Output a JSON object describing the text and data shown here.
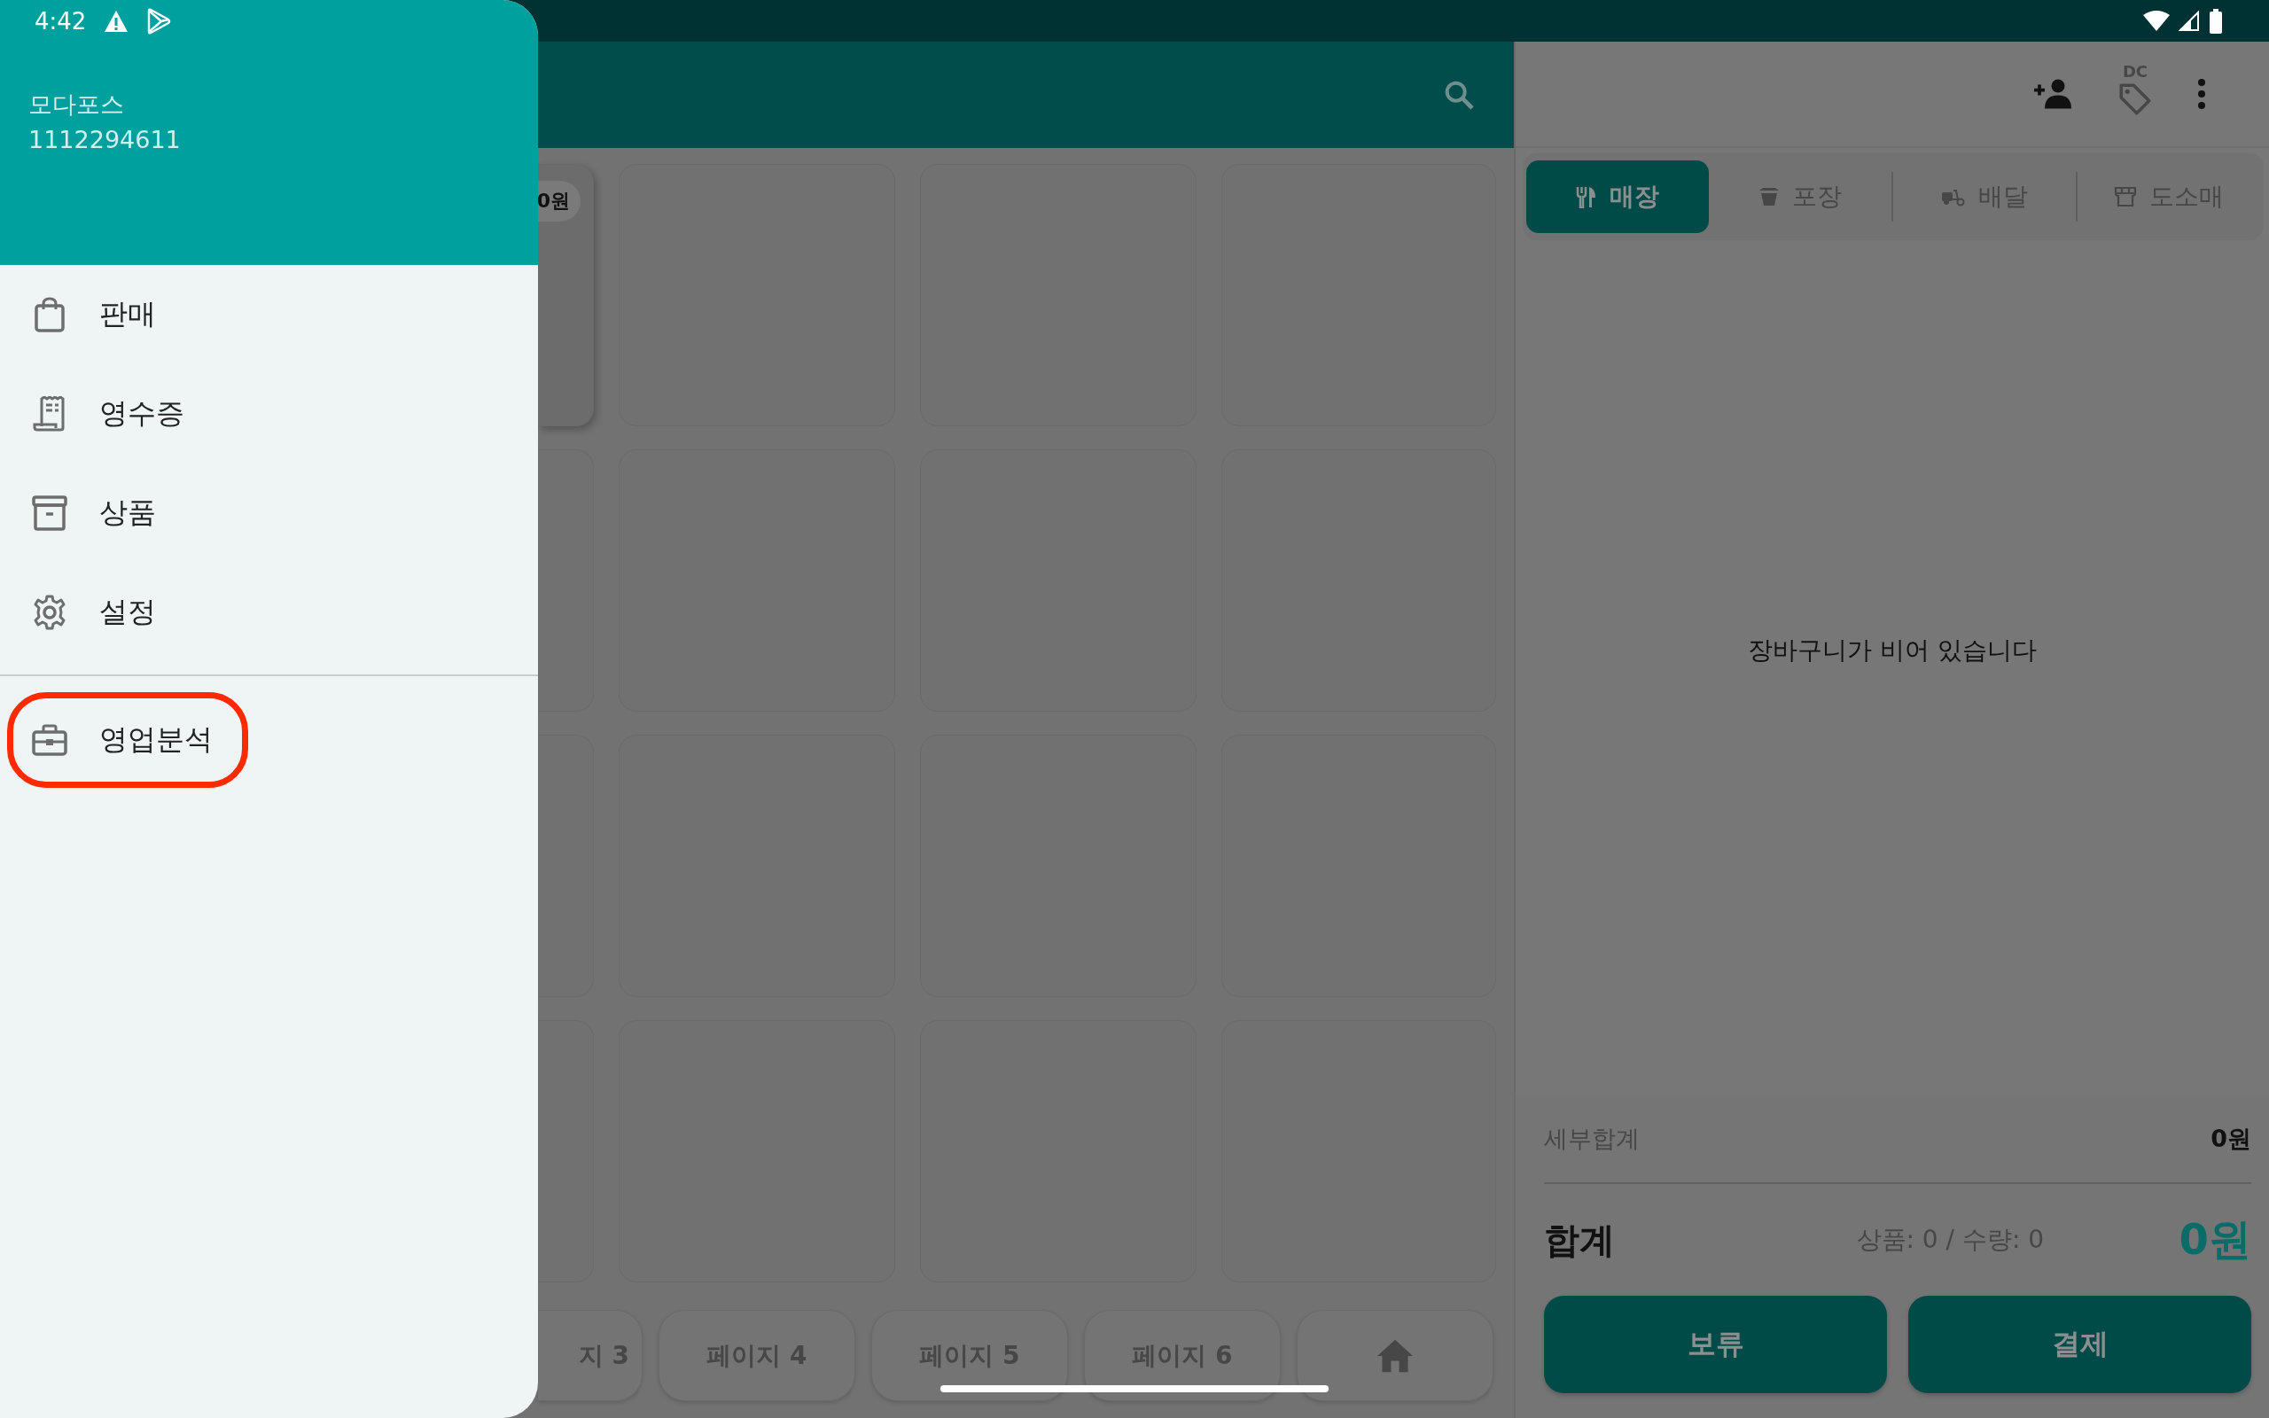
{
  "status_bar": {
    "time": "4:42"
  },
  "drawer": {
    "store_name": "모다포스",
    "store_id": "1112294611",
    "sections": [
      {
        "items": [
          {
            "label": "판매",
            "highlighted": false
          },
          {
            "label": "영수증",
            "highlighted": false
          },
          {
            "label": "상품",
            "highlighted": false
          },
          {
            "label": "설정",
            "highlighted": false
          }
        ]
      },
      {
        "items": [
          {
            "label": "영업분석",
            "highlighted": true
          }
        ]
      }
    ]
  },
  "product_grid": {
    "price_badge": "0원"
  },
  "page_tabs": [
    "지 3",
    "페이지 4",
    "페이지 5",
    "페이지 6"
  ],
  "cart": {
    "dc_label": "DC",
    "order_types": [
      {
        "label": "매장",
        "selected": true
      },
      {
        "label": "포장",
        "selected": false
      },
      {
        "label": "배달",
        "selected": false
      },
      {
        "label": "도소매",
        "selected": false
      }
    ],
    "empty_message": "장바구니가 비어 있습니다",
    "subtotal_label": "세부합계",
    "subtotal": "0원",
    "total_label": "합계",
    "counts": "상품: 0 / 수량: 0",
    "total": "0원",
    "buttons": [
      "보류",
      "결제"
    ]
  }
}
